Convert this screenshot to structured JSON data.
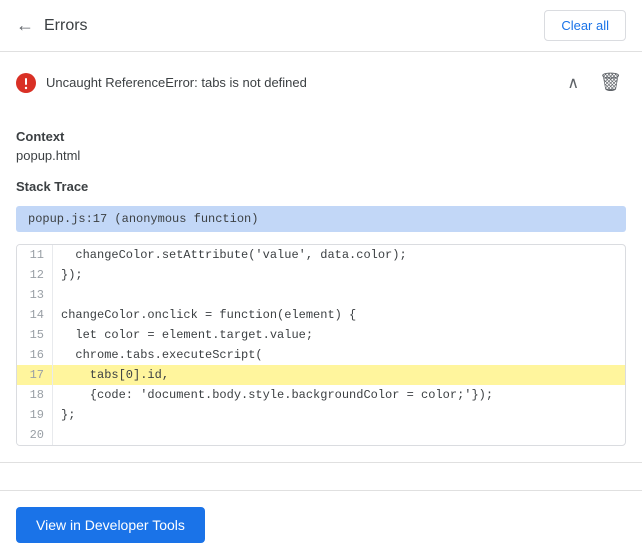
{
  "header": {
    "back_label": "←",
    "title": "Errors",
    "clear_all_label": "Clear all"
  },
  "error": {
    "message": "Uncaught ReferenceError: tabs is not defined",
    "context_label": "Context",
    "context_value": "popup.html",
    "stack_trace_label": "Stack Trace",
    "stack_trace_value": "popup.js:17 (anonymous function)",
    "delete_icon": "🗑",
    "chevron_icon": "∧"
  },
  "code_lines": [
    {
      "number": "11",
      "content": "  changeColor.setAttribute('value', data.color);",
      "highlighted": false
    },
    {
      "number": "12",
      "content": "});",
      "highlighted": false
    },
    {
      "number": "13",
      "content": "",
      "highlighted": false
    },
    {
      "number": "14",
      "content": "changeColor.onclick = function(element) {",
      "highlighted": false
    },
    {
      "number": "15",
      "content": "  let color = element.target.value;",
      "highlighted": false
    },
    {
      "number": "16",
      "content": "  chrome.tabs.executeScript(",
      "highlighted": false
    },
    {
      "number": "17",
      "content": "    tabs[0].id,",
      "highlighted": true
    },
    {
      "number": "18",
      "content": "    {code: 'document.body.style.backgroundColor = color;'});",
      "highlighted": false
    },
    {
      "number": "19",
      "content": "};",
      "highlighted": false
    },
    {
      "number": "20",
      "content": "",
      "highlighted": false
    }
  ],
  "footer": {
    "view_btn_label": "View in Developer Tools"
  },
  "colors": {
    "accent": "#1a73e8",
    "highlight_bg": "#fff59d",
    "stack_trace_bg": "#c2d7f7"
  }
}
